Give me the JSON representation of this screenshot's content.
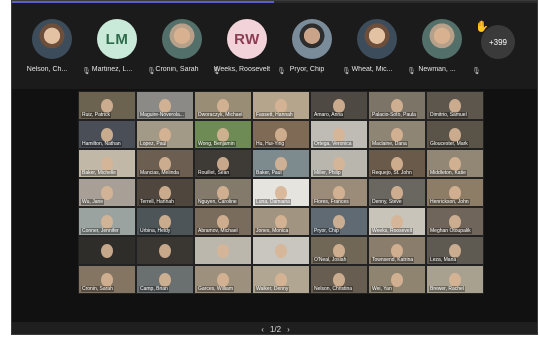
{
  "participants_top": [
    {
      "name": "Nelson, Ch...",
      "initials": "",
      "avatar_type": "photo"
    },
    {
      "name": "Martinez, L...",
      "initials": "LM",
      "avatar_color": "#c9ead9",
      "text_color": "#2e6b4b"
    },
    {
      "name": "Cronin, Sarah",
      "initials": "",
      "avatar_type": "photo2"
    },
    {
      "name": "Weeks, Roosevelt",
      "initials": "RW",
      "avatar_color": "#f3d3da",
      "text_color": "#8b3d51"
    },
    {
      "name": "Pryor, Chip",
      "initials": "",
      "avatar_type": "photo3"
    },
    {
      "name": "Wheat, Mic...",
      "initials": "",
      "avatar_type": "photo"
    },
    {
      "name": "Newman, ...",
      "initials": "",
      "avatar_type": "photo2"
    }
  ],
  "overflow_count": "+399",
  "raised_hand": "✋",
  "grid_labels": [
    "Ruiz, Patrick",
    "Maguire-Noverola...",
    "Dworaczyk, Michael",
    "Fassett, Hannah",
    "Amaro, Anna",
    "Palacio-Soto, Paula",
    "Dimitrio, Samuel",
    "Hamilton, Nathan",
    "Lopez, Paul",
    "Wong, Benjamin",
    "Hu, Hui-Ying",
    "Ortega, Veronica",
    "Maclaine, Dana",
    "Gloucester, Mark",
    "Baker, Michelle",
    "Mancias, Melinda",
    "Rouillet, Sean",
    "Baker, Paul",
    "Miller, Philip",
    "Requejo, St. John",
    "Middleton, Katie",
    "Wu, Jane",
    "Terrell, Hannah",
    "Nguyen, Caroline",
    "Luna, Damiana",
    "Flores, Frances",
    "Denny, Steve",
    "Henrickson, John",
    "Conner, Jennifer",
    "Urbina, Heidy",
    "Abramov, Michael",
    "Jones, Monica",
    "Pryor, Chip",
    "Weeks, Roosevelt",
    "Meghan Otoupalik",
    "",
    "",
    "",
    "",
    "O'Neal, Josiah",
    "Townsend, Katrina",
    "Leza, Maria",
    "Cronin, Sarah",
    "Camp, Brian",
    "Garces, William",
    "Walker, Denny",
    "Nelson, Christina",
    "Wei, Yan",
    "Brewer, Rachel"
  ],
  "tile_colors": [
    "#6b6250",
    "#8b8a86",
    "#9a8d76",
    "#b5a58c",
    "#4e4a43",
    "#7d7468",
    "#5c564c",
    "#4a4f57",
    "#a39987",
    "#6e8a55",
    "#7f6a55",
    "#bfbcb5",
    "#8e8574",
    "#5a5348",
    "#c2b8a8",
    "#6c5f51",
    "#3e3a35",
    "#7e8b8e",
    "#b9b6ad",
    "#6a5a49",
    "#928674",
    "#a8a096",
    "#4f473d",
    "#847a6b",
    "#e6e4de",
    "#9b8c7a",
    "#6a6660",
    "#8d7d67",
    "#9aa39f",
    "#4e5558",
    "#7a6c5c",
    "#a19480",
    "#5f6a73",
    "#c8c4ba",
    "#6f655a",
    "#2f2d2a",
    "#3a3632",
    "#bcb7ad",
    "#c9c6bf",
    "#716756",
    "#8a7d6c",
    "#5e5a52",
    "#847562",
    "#6a6f70",
    "#9d907c",
    "#b1a692",
    "#675d51",
    "#8e8470",
    "#a8a18f"
  ],
  "pager": {
    "prev": "‹",
    "page": "1/2",
    "next": "›"
  },
  "colors": {
    "accent": "#5b5fc7"
  }
}
